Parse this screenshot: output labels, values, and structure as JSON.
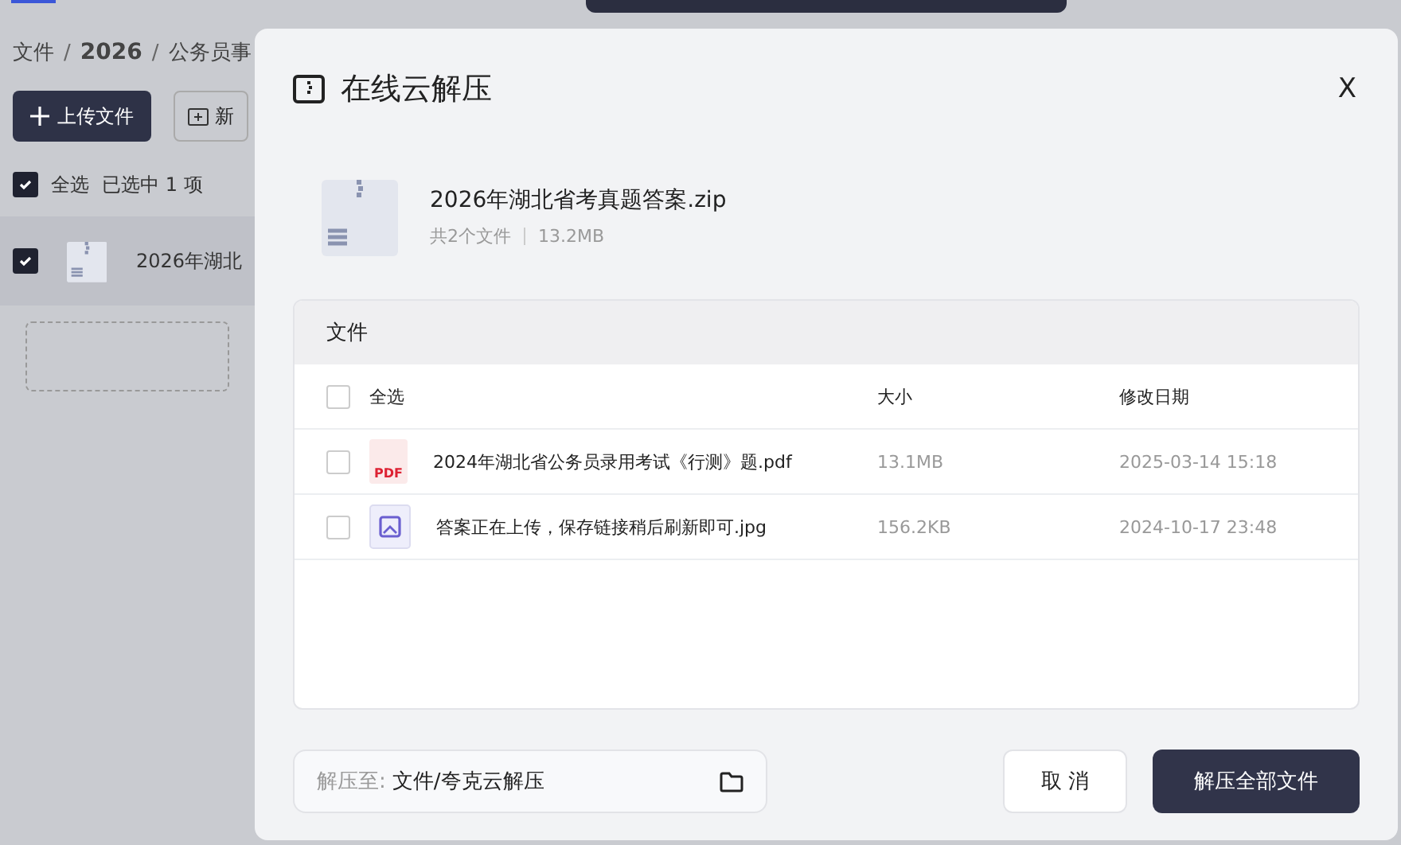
{
  "background": {
    "breadcrumb": [
      "文件",
      "2026",
      "公务员事"
    ],
    "separator": "/",
    "upload_button": "上传文件",
    "new_button": "新",
    "select_all": {
      "label": "全选",
      "checked": true,
      "summary": "已选中 1 项"
    },
    "rows": [
      {
        "name": "2026年湖北",
        "checked": true
      }
    ]
  },
  "dialog": {
    "title": "在线云解压",
    "close": "X",
    "archive": {
      "name": "2026年湖北省考真题答案.zip",
      "count": "共2个文件",
      "size": "13.2MB"
    },
    "panel_title": "文件",
    "columns": {
      "select_all": "全选",
      "checked": false,
      "size": "大小",
      "date": "修改日期"
    },
    "files": [
      {
        "kind": "pdf",
        "icon_text": "PDF",
        "name": "2024年湖北省公务员录用考试《行测》题.pdf",
        "size": "13.1MB",
        "date": "2025-03-14 15:18",
        "checked": false
      },
      {
        "kind": "image",
        "name": "答案正在上传，保存链接稍后刷新即可.jpg",
        "size": "156.2KB",
        "date": "2024-10-17 23:48",
        "checked": false
      }
    ],
    "destination": {
      "label": "解压至:",
      "path": "文件/夸克云解压"
    },
    "cancel": "取 消",
    "confirm": "解压全部文件"
  }
}
